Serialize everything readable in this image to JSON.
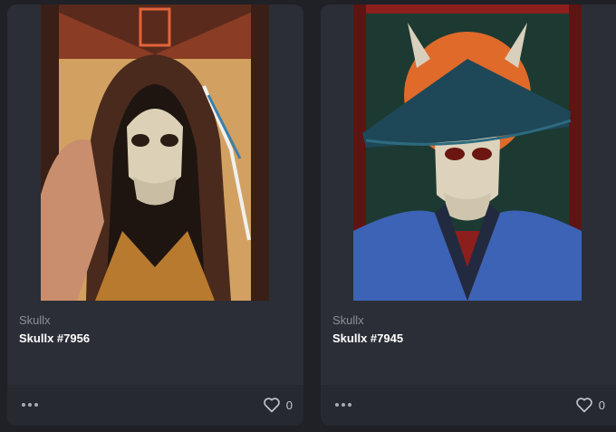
{
  "cards": [
    {
      "collection": "Skullx",
      "title": "Skullx #7956",
      "likes": "0",
      "image_icon": "hooded-skull-artwork"
    },
    {
      "collection": "Skullx",
      "title": "Skullx #7945",
      "likes": "0",
      "image_icon": "samurai-skull-artwork"
    }
  ],
  "colors": {
    "card_bg": "#2b2e36",
    "footer_bg": "#262930",
    "page_bg": "#1f2127",
    "muted_text": "#8a8f99"
  }
}
